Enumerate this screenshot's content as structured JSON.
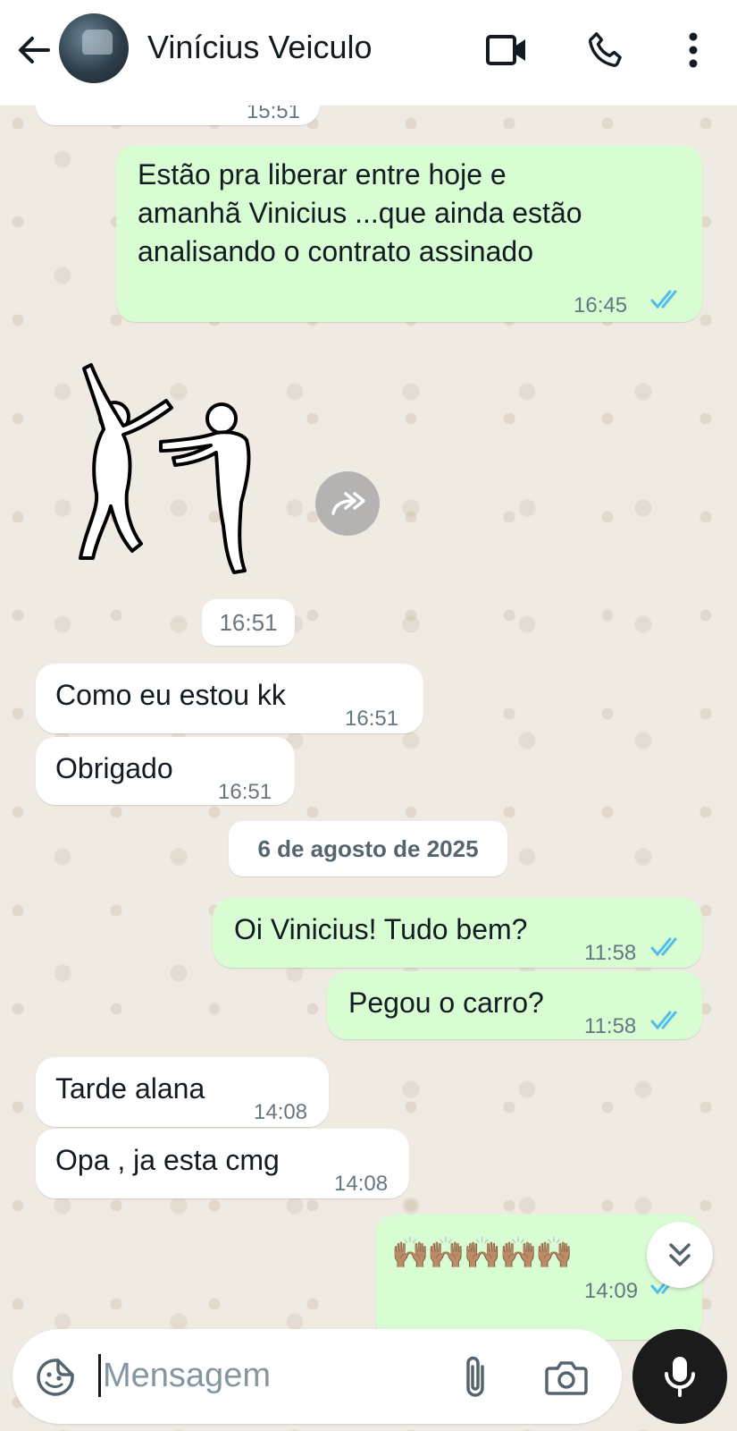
{
  "header": {
    "contact_name": "Vinícius Veiculo"
  },
  "messages": [
    {
      "dir": "in",
      "text": "",
      "time": "15:51"
    },
    {
      "dir": "out",
      "lines": [
        "Estão pra liberar entre hoje e",
        "amanhã Vinicius ...que ainda estão",
        "analisando o contrato assinado"
      ],
      "time": "16:45"
    },
    {
      "dir": "in",
      "type": "sticker",
      "time": "16:51"
    },
    {
      "dir": "in",
      "text": "Como eu estou kk",
      "time": "16:51"
    },
    {
      "dir": "in",
      "text": "Obrigado",
      "time": "16:51"
    },
    {
      "dir": "out",
      "text": "Oi Vinicius! Tudo bem?",
      "time": "11:58"
    },
    {
      "dir": "out",
      "text": "Pegou o carro?",
      "time": "11:58"
    },
    {
      "dir": "in",
      "text": "Tarde alana",
      "time": "14:08"
    },
    {
      "dir": "in",
      "text": "Opa , ja esta cmg",
      "time": "14:08"
    },
    {
      "dir": "out",
      "text": "🙌🏽🙌🏽🙌🏽🙌🏽🙌🏽",
      "time": "14:09"
    }
  ],
  "date_separator": "6 de agosto de 2025",
  "composer": {
    "placeholder": "Mensagem"
  },
  "icons": {
    "back": "arrow-left-icon",
    "video": "video-camera-icon",
    "call": "phone-icon",
    "menu": "more-vertical-icon",
    "sticker": "sticker-icon",
    "attach": "paperclip-icon",
    "camera": "camera-icon",
    "mic": "microphone-icon",
    "forward": "forward-icon",
    "scroll": "chevrons-down-icon"
  },
  "colors": {
    "outgoing_bubble": "#d9fdd3",
    "incoming_bubble": "#ffffff",
    "read_ticks": "#53bdeb",
    "wallpaper": "#efeae2"
  }
}
